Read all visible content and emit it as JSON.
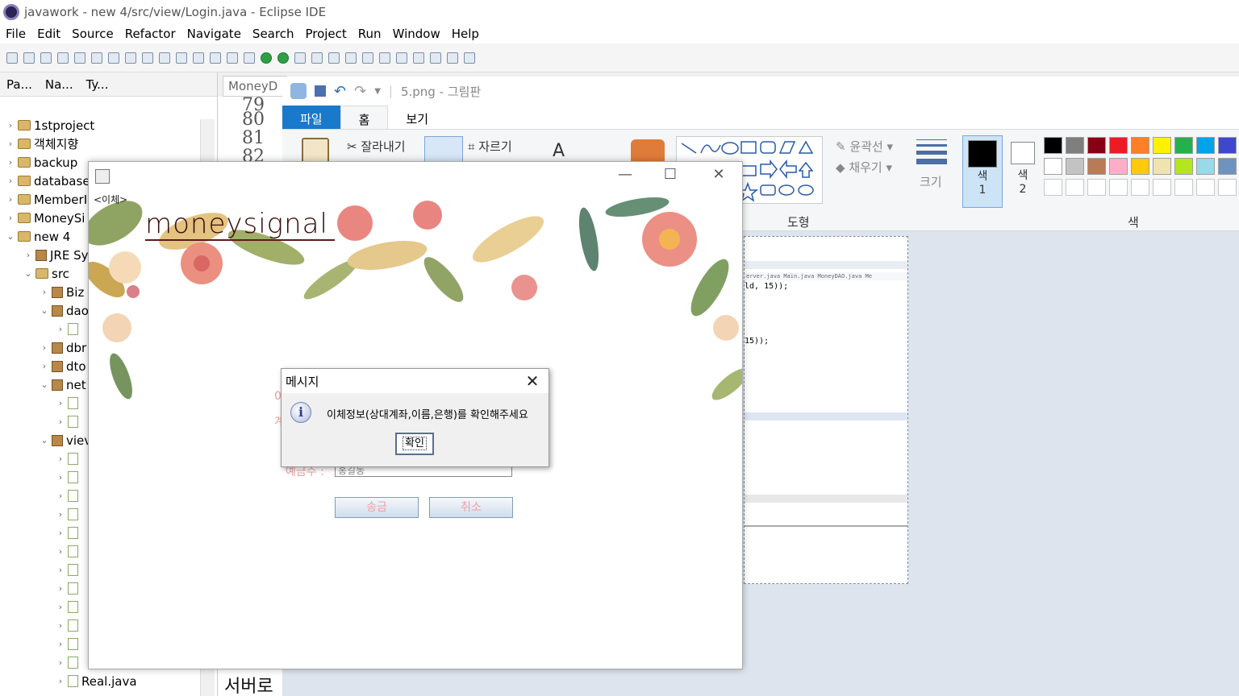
{
  "eclipse": {
    "title": "javawork - new 4/src/view/Login.java - Eclipse IDE",
    "menu": [
      "File",
      "Edit",
      "Source",
      "Refactor",
      "Navigate",
      "Search",
      "Project",
      "Run",
      "Window",
      "Help"
    ],
    "panel_tabs": [
      "Pa...",
      "Na...",
      "Ty..."
    ],
    "tree": [
      {
        "label": "1stproject",
        "type": "folder"
      },
      {
        "label": "객체지향",
        "type": "folder"
      },
      {
        "label": "backup",
        "type": "folder"
      },
      {
        "label": "database",
        "type": "folder"
      },
      {
        "label": "MemberI",
        "type": "folder"
      },
      {
        "label": "MoneySi",
        "type": "folder"
      },
      {
        "label": "new 4",
        "type": "folder"
      },
      {
        "label": "JRE Sy",
        "type": "lib"
      },
      {
        "label": "src",
        "type": "src"
      },
      {
        "label": "Biz",
        "type": "pkg"
      },
      {
        "label": "dao",
        "type": "pkg"
      },
      {
        "label": "",
        "type": "java"
      },
      {
        "label": "dbr",
        "type": "pkg"
      },
      {
        "label": "dto",
        "type": "pkg"
      },
      {
        "label": "net",
        "type": "pkg"
      },
      {
        "label": "",
        "type": "java"
      },
      {
        "label": "",
        "type": "java"
      },
      {
        "label": "viev",
        "type": "pkg"
      },
      {
        "label": "Real.java",
        "type": "java"
      }
    ],
    "editor_tab": "MoneyD",
    "line_numbers": [
      "79",
      "80",
      "81",
      "82"
    ],
    "editor_bottom_text": "서버로"
  },
  "paint": {
    "title": "5.png - 그림판",
    "tabs": [
      "파일",
      "홈",
      "보기"
    ],
    "cut_label": "잘라내기",
    "crop_label": "자르기",
    "outline_label": "윤곽선",
    "fill_label": "채우기",
    "size_label": "크기",
    "color1_label": "색",
    "color1_num": "1",
    "color2_label": "색",
    "color2_num": "2",
    "shapes_group": "도형",
    "colors_group": "색",
    "palette": [
      "#000000",
      "#7f7f7f",
      "#880015",
      "#ed1c24",
      "#ff7f27",
      "#fff200",
      "#22b14c",
      "#00a2e8",
      "#3f48cc",
      "#ffffff",
      "#c3c3c3",
      "#b97a57",
      "#ffaec9",
      "#ffc90e",
      "#efe4b0",
      "#b5e61d",
      "#99d9ea",
      "#7092be"
    ],
    "canvas_tabs": "erver.java   Main.java   MoneyDAO.java   Me",
    "canvas_code1": "ld, 15));",
    "canvas_code2": "15));"
  },
  "java_window": {
    "label_top": "<이체>",
    "logo": "moneysignal",
    "recv_label": "예금주 :",
    "recv_value": "홍길동",
    "send_button": "송금",
    "cancel_button": "취소",
    "partial_label_1": "0",
    "partial_label_2": "계"
  },
  "dialog": {
    "title": "메시지",
    "icon": "i",
    "message": "이체정보(상대계좌,이름,은행)를 확인해주세요",
    "ok_label": "확인"
  }
}
